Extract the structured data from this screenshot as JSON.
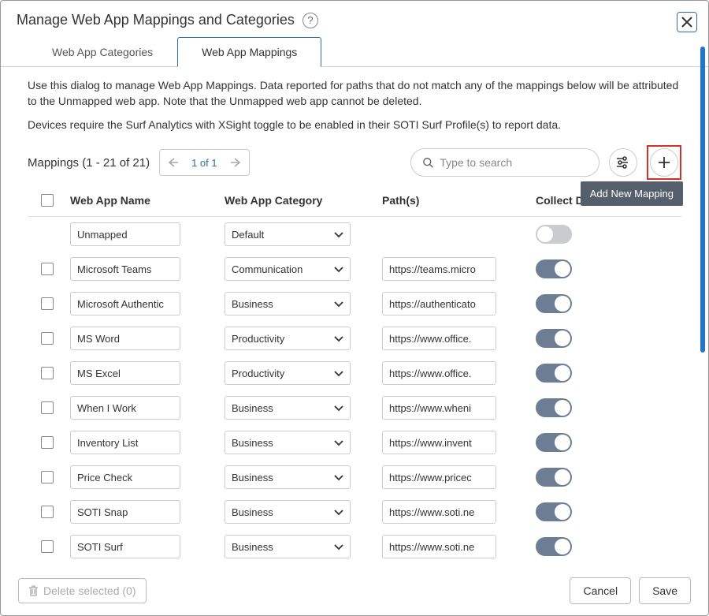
{
  "dialog": {
    "title": "Manage Web App Mappings and Categories",
    "close_aria": "Close"
  },
  "tabs": {
    "categories": "Web App Categories",
    "mappings": "Web App Mappings"
  },
  "description": {
    "line1": "Use this dialog to manage Web App Mappings. Data reported for paths that do not match any of the mappings below will be attributed to the Unmapped web app. Note that the Unmapped web app cannot be deleted.",
    "line2": "Devices require the Surf Analytics with XSight toggle to be enabled in their SOTI Surf Profile(s) to report data."
  },
  "toolbar": {
    "count_label": "Mappings (1 - 21 of 21)",
    "page_label": "1 of 1",
    "search_placeholder": "Type to search",
    "tooltip_add": "Add New Mapping"
  },
  "columns": {
    "name": "Web App Name",
    "category": "Web App Category",
    "path": "Path(s)",
    "collect": "Collect Data"
  },
  "rows": [
    {
      "name": "Unmapped",
      "category": "Default",
      "path": "",
      "collect": false,
      "disabled": true,
      "no_check": true
    },
    {
      "name": "Microsoft Teams",
      "category": "Communication",
      "path": "https://teams.micro",
      "collect": true
    },
    {
      "name": "Microsoft Authentic",
      "category": "Business",
      "path": "https://authenticato",
      "collect": true
    },
    {
      "name": "MS Word",
      "category": "Productivity",
      "path": "https://www.office.",
      "collect": true
    },
    {
      "name": "MS Excel",
      "category": "Productivity",
      "path": "https://www.office.",
      "collect": true
    },
    {
      "name": "When I Work",
      "category": "Business",
      "path": "https://www.wheni",
      "collect": true
    },
    {
      "name": "Inventory List",
      "category": "Business",
      "path": "https://www.invent",
      "collect": true
    },
    {
      "name": "Price Check",
      "category": "Business",
      "path": "https://www.pricec",
      "collect": true
    },
    {
      "name": "SOTI Snap",
      "category": "Business",
      "path": "https://www.soti.ne",
      "collect": true
    },
    {
      "name": "SOTI Surf",
      "category": "Business",
      "path": "https://www.soti.ne",
      "collect": true
    }
  ],
  "footer": {
    "delete_label": "Delete selected (0)",
    "cancel": "Cancel",
    "save": "Save"
  }
}
